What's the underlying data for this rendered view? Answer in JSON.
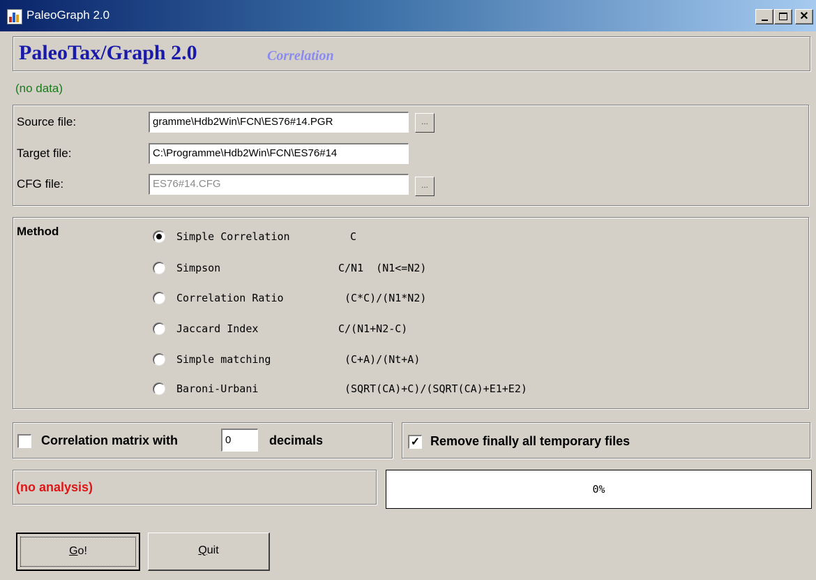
{
  "window": {
    "title": "PaleoGraph 2.0",
    "controls": {
      "minimize": "_",
      "maximize": "□",
      "close": "✕"
    }
  },
  "header": {
    "app_name": "PaleoTax/Graph 2.0",
    "module": "Correlation",
    "data_status": "(no data)"
  },
  "files": {
    "source_label": "Source file:",
    "source_value": "gramme\\Hdb2Win\\FCN\\ES76#14.PGR",
    "target_label": "Target file:",
    "target_value": "C:\\Programme\\Hdb2Win\\FCN\\ES76#14",
    "cfg_label": "CFG file:",
    "cfg_value": "ES76#14.CFG",
    "browse_label": "..."
  },
  "method": {
    "title": "Method",
    "options": [
      {
        "name": "Simple Correlation",
        "formula": "C",
        "selected": true
      },
      {
        "name": "Simpson",
        "formula": "C/N1  (N1<=N2)",
        "selected": false
      },
      {
        "name": "Correlation Ratio",
        "formula": "(C*C)/(N1*N2)",
        "selected": false
      },
      {
        "name": "Jaccard Index",
        "formula": "C/(N1+N2-C)",
        "selected": false
      },
      {
        "name": "Simple matching",
        "formula": "(C+A)/(Nt+A)",
        "selected": false
      },
      {
        "name": "Baroni-Urbani",
        "formula": "(SQRT(CA)+C)/(SQRT(CA)+E1+E2)",
        "selected": false
      }
    ]
  },
  "options": {
    "matrix_label": "Correlation matrix with",
    "matrix_checked": false,
    "decimals_value": "0",
    "decimals_label": "decimals",
    "remove_temp_label": "Remove finally all temporary files",
    "remove_temp_checked": true
  },
  "analysis": {
    "status": "(no analysis)",
    "progress_percent": 0,
    "progress_text": "0%"
  },
  "buttons": {
    "go_key": "G",
    "go_rest": "o!",
    "quit_key": "Q",
    "quit_rest": "uit"
  },
  "colors": {
    "dialog_bg": "#d4d0c8",
    "title_gradient_start": "#0a246a",
    "heading": "#1a1aa8",
    "subheading": "#8a8aef",
    "data_status": "#1a7a1a",
    "analysis_status": "#e01515"
  }
}
